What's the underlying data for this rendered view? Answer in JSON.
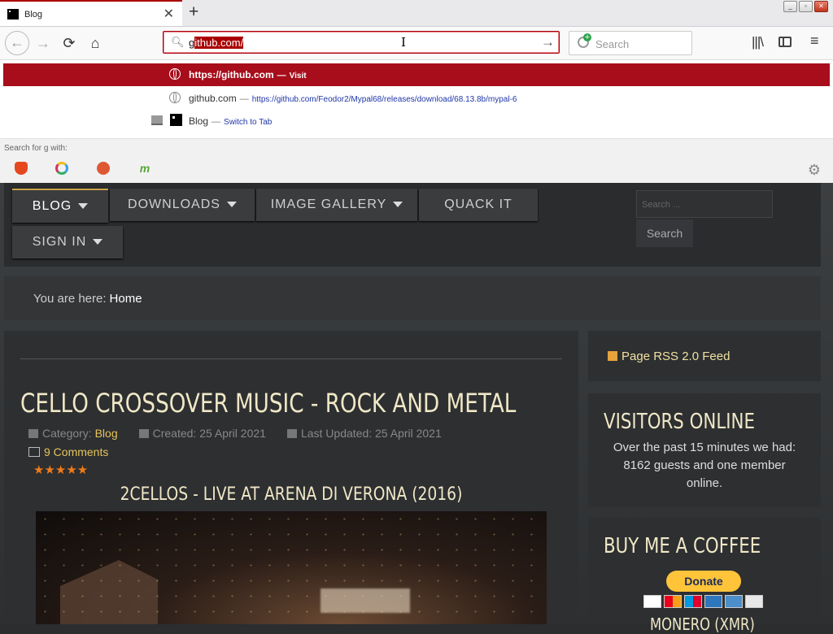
{
  "browser": {
    "tab": {
      "title": "Blog",
      "close": "✕"
    },
    "new_tab": "+",
    "window_buttons": [
      "_",
      "▫",
      "✕"
    ],
    "url": {
      "typed": "g",
      "completion": "ithub.com/"
    },
    "go_icon": "→",
    "search_placeholder": "Search",
    "icons": {
      "back": "←",
      "forward": "→",
      "reload": "⟳",
      "home": "⌂",
      "library": "|||\\",
      "menu": "≡"
    }
  },
  "dropdown": {
    "rows": [
      {
        "main": "https://github.com",
        "sep": "—",
        "sub": "Visit"
      },
      {
        "main": "github.com",
        "sep": "—",
        "sub": "https://github.com/Feodor2/Mypal68/releases/download/68.13.8b/mypal-6"
      },
      {
        "main": "Blog",
        "sep": "—",
        "sub": "Switch to Tab"
      }
    ],
    "search_for": "Search for g with:",
    "engines": [
      "brave",
      "qwant",
      "duckduckgo",
      "m"
    ]
  },
  "site": {
    "menu": {
      "blog": "BLOG",
      "downloads": "DOWNLOADS",
      "gallery": "IMAGE GALLERY",
      "quack": "QUACK IT",
      "signin": "SIGN IN"
    },
    "search": {
      "placeholder": "Search ...",
      "button": "Search"
    },
    "breadcrumb": {
      "label": "You are here:",
      "home": "Home"
    },
    "article": {
      "title": "CELLO CROSSOVER MUSIC - ROCK AND METAL",
      "category_label": "Category:",
      "category": "Blog",
      "created": "Created: 25 April 2021",
      "updated": "Last Updated: 25 April 2021",
      "comments": "9 Comments",
      "rating_stars": 5,
      "stars": "★★★★★",
      "video_title": "2CELLOS - LIVE AT ARENA DI VERONA (2016)"
    },
    "rss": "Page RSS 2.0 Feed",
    "visitors": {
      "heading": "VISITORS ONLINE",
      "text": "Over the past 15 minutes we had: 8162 guests and one member online."
    },
    "coffee": {
      "heading": "BUY ME A COFFEE",
      "donate": "Donate",
      "monero": "MONERO (XMR)"
    }
  },
  "colors": {
    "accent": "#a80d1b",
    "link": "#e6c45a",
    "heading": "#f0e7c6",
    "star": "#f07b17"
  }
}
